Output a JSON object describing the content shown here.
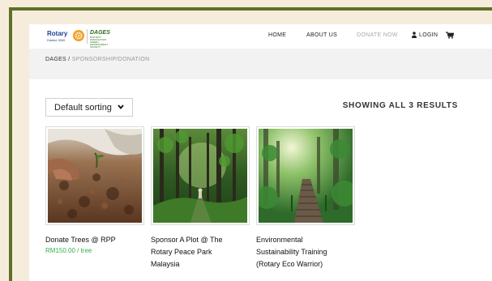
{
  "header": {
    "rotary_word": "Rotary",
    "rotary_district": "District 3300",
    "dages_word": "DAGES",
    "dages_tag": "DISTRICT ASSOCIATION GREEN ENVIRONMENT SOCIETY",
    "nav": [
      "HOME",
      "ABOUT US",
      "DONATE NOW",
      "LOGIN"
    ]
  },
  "breadcrumb": {
    "home": "DAGES",
    "sep": " / ",
    "current": "SPONSORSHIP/DONATION"
  },
  "sort": {
    "selected": "Default sorting"
  },
  "results_text": "SHOWING ALL 3 RESULTS",
  "products": [
    {
      "title_lines": [
        "Donate Trees @ RPP"
      ],
      "price": "RM150.00 / tree",
      "image": "soil-planting"
    },
    {
      "title_lines": [
        "Sponsor A Plot @ The",
        "Rotary Peace Park",
        "Malaysia"
      ],
      "price": "",
      "image": "forest-walk"
    },
    {
      "title_lines": [
        "Environmental",
        "Sustainability Training",
        "(Rotary Eco Warrior)"
      ],
      "price": "",
      "image": "forest-boardwalk"
    }
  ],
  "colors": {
    "border_green": "#5e7126",
    "price_green": "#2fb24c",
    "rotary_blue": "#1c3f8f",
    "rotary_gold": "#f0a22a"
  }
}
